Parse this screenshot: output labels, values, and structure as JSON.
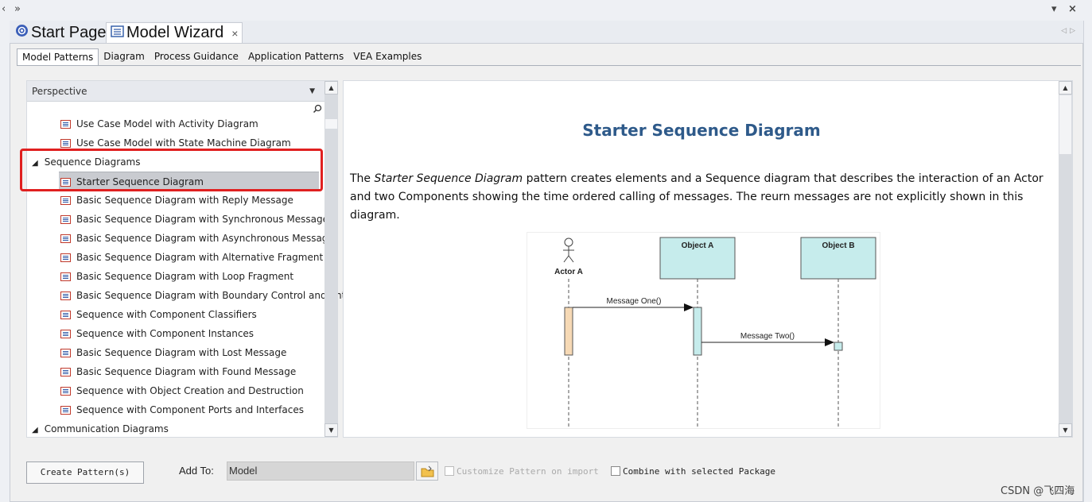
{
  "topbar": {
    "left_chevron": "‹",
    "expand_glyph": "»",
    "dropdown_glyph": "▾",
    "close_glyph": "×"
  },
  "doc_tabs": [
    {
      "label": "Start Page",
      "icon": "start-page-icon"
    },
    {
      "label": "Model Wizard",
      "icon": "model-wizard-icon",
      "close": "×"
    }
  ],
  "sub_tabs": [
    "Model Patterns",
    "Diagram",
    "Process Guidance",
    "Application Patterns",
    "VEA Examples"
  ],
  "tree": {
    "perspective_label": "Perspective",
    "items_top": [
      "Use Case Model with Activity Diagram",
      "Use Case Model with State Machine Diagram"
    ],
    "group_sequence": "Sequence Diagrams",
    "selected_item": "Starter Sequence Diagram",
    "items_sequence": [
      "Basic Sequence Diagram with Reply Message",
      "Basic Sequence Diagram with Synchronous Message",
      "Basic Sequence Diagram with Asynchronous Message",
      "Basic Sequence Diagram with Alternative Fragment",
      "Basic Sequence Diagram with Loop Fragment",
      "Basic Sequence Diagram with Boundary Control and Entity",
      "Sequence with Component Classifiers",
      "Sequence with Component Instances",
      "Basic Sequence Diagram with Lost Message",
      "Basic Sequence Diagram with Found Message",
      "Sequence with Object Creation and Destruction",
      "Sequence with Component Ports and Interfaces"
    ],
    "group_communication": "Communication Diagrams"
  },
  "preview": {
    "title": "Starter Sequence Diagram",
    "desc_prefix": "The ",
    "desc_em": "Starter Sequence Diagram",
    "desc_rest": " pattern creates elements and a Sequence diagram that describes the interaction of an Actor and two Components showing the time ordered calling of messages. The reurn messages are not explicitly shown in this diagram.",
    "diagram": {
      "actor": "Actor A",
      "object_a": "Object A",
      "object_b": "Object B",
      "message_one": "Message One()",
      "message_two": "Message Two()"
    }
  },
  "bottom": {
    "create_button": "Create Pattern(s)",
    "add_to_label": "Add To:",
    "add_to_value": "Model",
    "customize_label": "Customize Pattern on import",
    "combine_label": "Combine with selected Package"
  },
  "watermark": "CSDN @飞四海",
  "colors": {
    "title_blue": "#2e5a8a",
    "highlight_red": "#e02020",
    "object_fill": "#c6ecec",
    "actor_activation": "#f6d9b5"
  }
}
